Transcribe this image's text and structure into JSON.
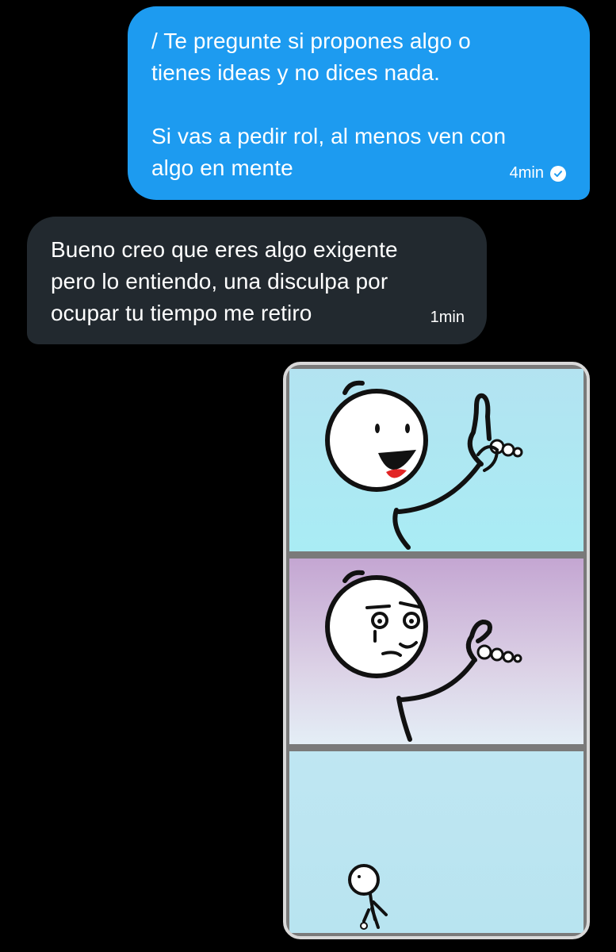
{
  "messages": [
    {
      "direction": "outgoing",
      "text": "/ Te pregunte si propones algo o\ntienes ideas y no dices nada.\n\nSi vas a pedir rol, al menos ven con\nalgo en mente",
      "time": "4min",
      "status_icon": "check-circle-icon",
      "bubble_color": "#1d9bf0"
    },
    {
      "direction": "incoming",
      "text": "Bueno creo que eres algo exigente\npero lo entiendo, una disculpa por\nocupar tu tiempo me retiro",
      "time": "1min",
      "bubble_color": "#22292f"
    }
  ],
  "attachment": {
    "type": "image",
    "description_panels": [
      "stickman-raising-finger",
      "stickman-skeptical-finger",
      "tiny-stickman-walking-away"
    ]
  }
}
